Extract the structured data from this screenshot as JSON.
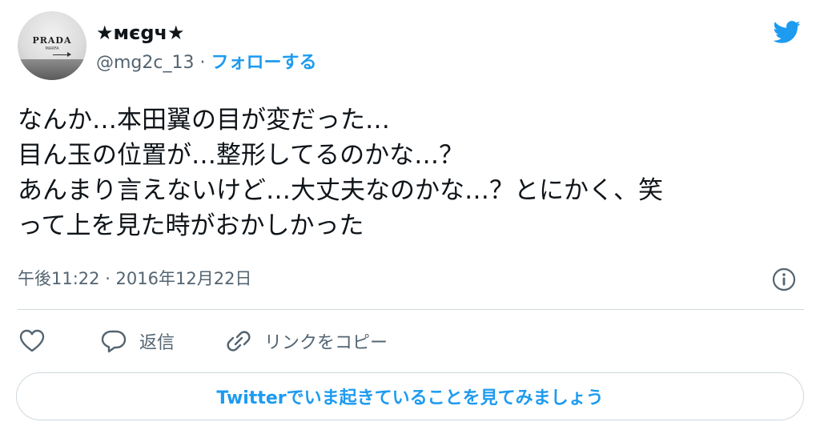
{
  "author": {
    "display_name": "★мєgч★",
    "handle": "@mg2c_13",
    "separator": "·",
    "follow_label": "フォローする",
    "avatar": {
      "brand_text": "PRADA",
      "sub_text": "MARFA"
    }
  },
  "tweet": {
    "text": "なんか…本田翼の目が変だった…\n目ん玉の位置が…整形してるのかな…？\nあんまり言えないけど…大丈夫なのかな…？とにかく、笑\nって上を見た時がおかしかった",
    "timestamp": "午後11:22 · 2016年12月22日"
  },
  "actions": {
    "like_icon": "heart-icon",
    "reply_label": "返信",
    "reply_icon": "speech-bubble-icon",
    "copy_link_label": "リンクをコピー",
    "copy_link_icon": "link-icon"
  },
  "cta": {
    "label": "Twitterでいま起きていることを見てみましょう"
  },
  "colors": {
    "accent": "#1d9bf0",
    "text": "#0f1419",
    "muted": "#536471",
    "border": "#cfd9de"
  }
}
